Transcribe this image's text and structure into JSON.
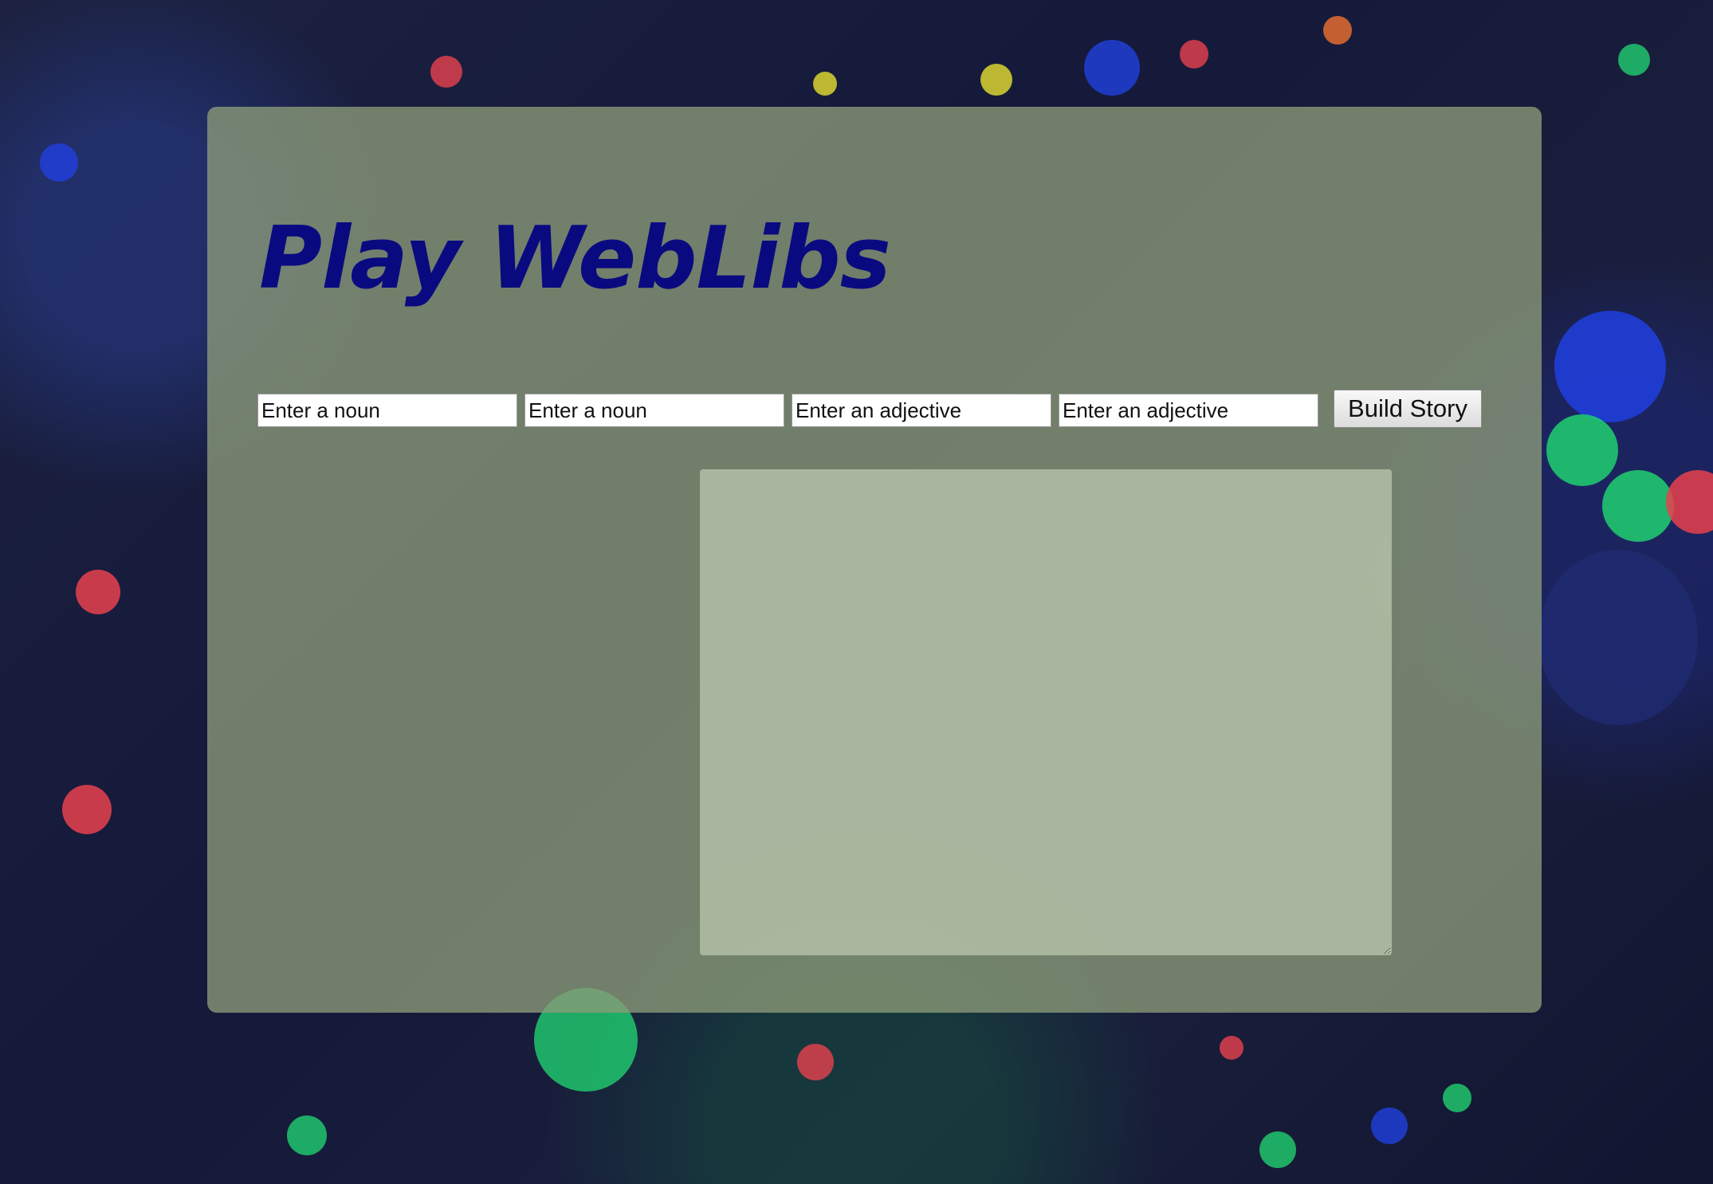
{
  "page": {
    "title": "Play WebLibs"
  },
  "inputs": [
    {
      "placeholder": "Enter a noun",
      "value": ""
    },
    {
      "placeholder": "Enter a noun",
      "value": ""
    },
    {
      "placeholder": "Enter an adjective",
      "value": ""
    },
    {
      "placeholder": "Enter an adjective",
      "value": ""
    }
  ],
  "build_button": {
    "label": "Build Story"
  },
  "story_output": {
    "value": ""
  },
  "colors": {
    "title": "#0a0a80",
    "card_background": "#8c9b78",
    "page_background": "#1a1f3c"
  }
}
